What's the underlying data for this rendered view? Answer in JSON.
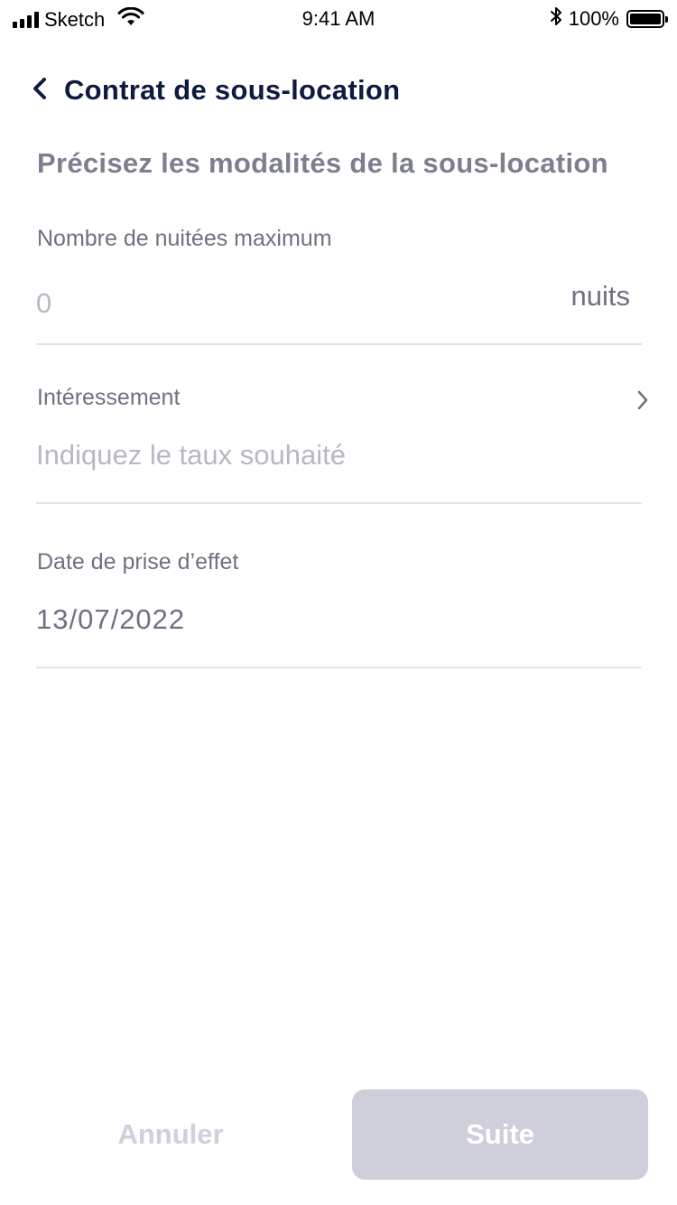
{
  "status_bar": {
    "carrier": "Sketch",
    "time": "9:41 AM",
    "battery": "100%",
    "signal_bars": 4,
    "icons": [
      "signal-icon",
      "wifi-icon",
      "bluetooth-icon",
      "battery-icon"
    ]
  },
  "nav": {
    "title": "Contrat de sous-location",
    "back_icon": "chevron-left-icon"
  },
  "heading": "Précisez les modalités de la sous-location",
  "fields": {
    "nights": {
      "label": "Nombre de nuitées maximum",
      "placeholder": "0",
      "value": "",
      "unit": "nuits"
    },
    "interest": {
      "label": "Intéressement",
      "placeholder": "Indiquez le taux souhaité",
      "value": "",
      "icon": "chevron-right-icon"
    },
    "start_date": {
      "label": "Date de prise d’effet",
      "value": "13/07/2022"
    }
  },
  "actions": {
    "cancel_label": "Annuler",
    "next_label": "Suite"
  },
  "colors": {
    "title": "#0f1a40",
    "muted_text": "#6f7180",
    "placeholder": "#b6b8c3",
    "divider": "#e3e3e6",
    "button_disabled_bg": "#cfcfdc",
    "button_disabled_text": "#cfd0dc"
  }
}
